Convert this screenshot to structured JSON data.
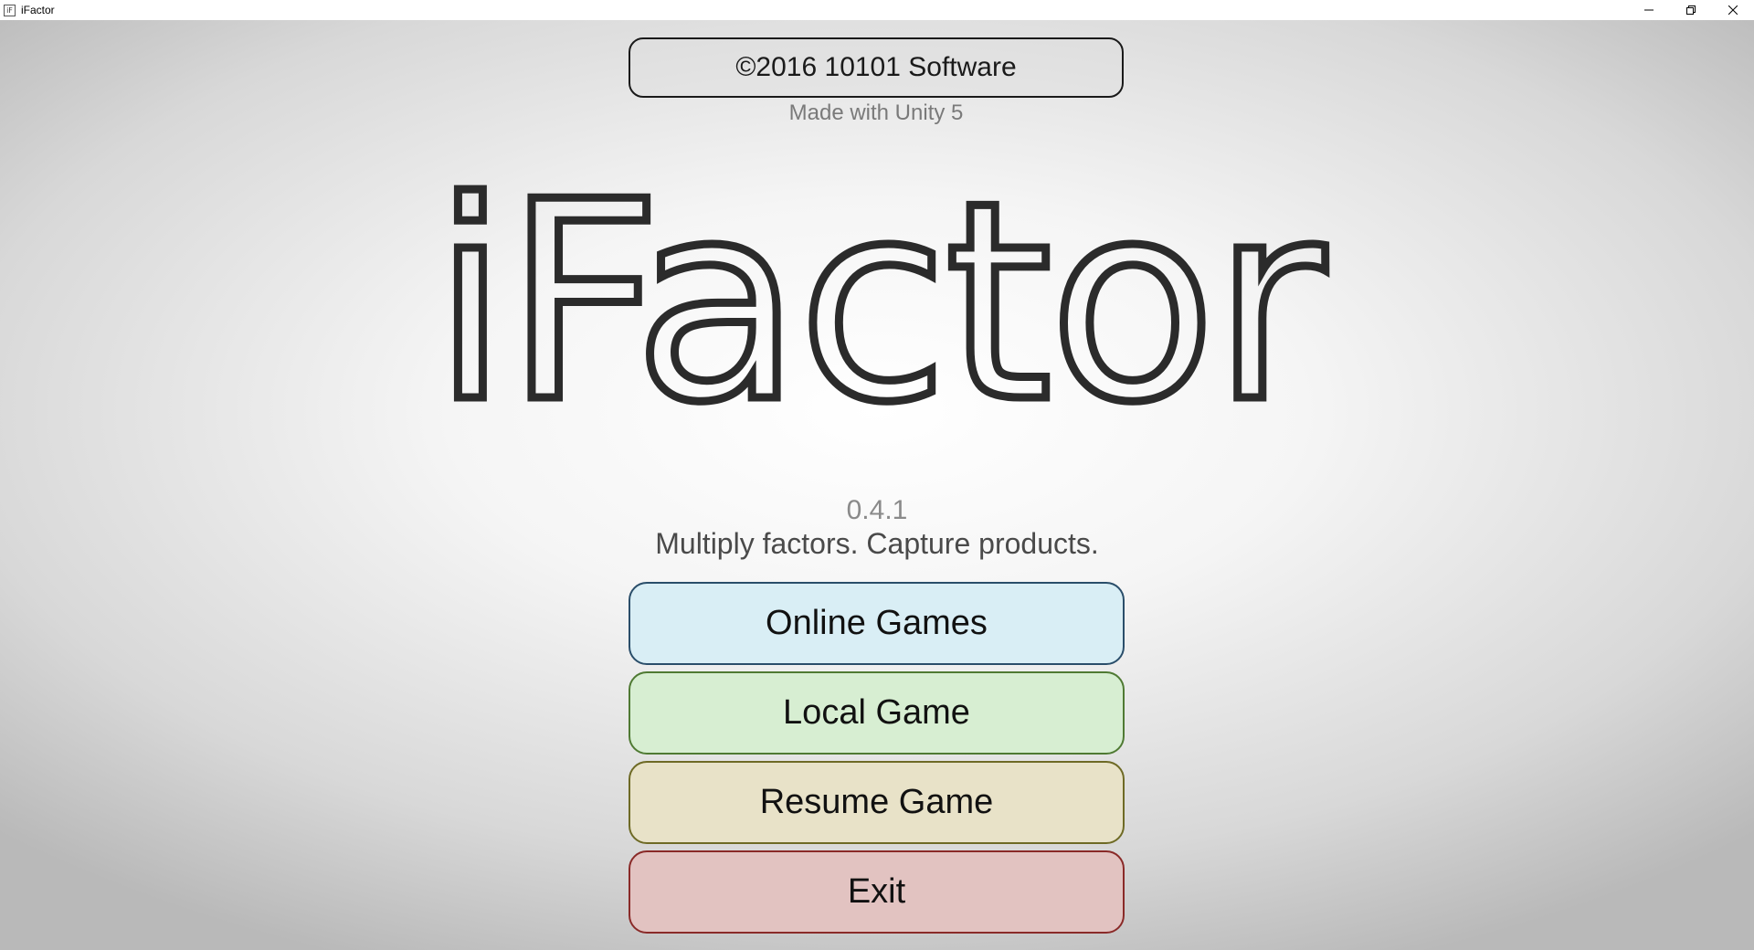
{
  "window": {
    "title": "iFactor",
    "icon_glyph": "iF"
  },
  "header": {
    "copyright": "©2016 10101 Software",
    "made_with": "Made with Unity 5"
  },
  "logo": {
    "text": "iFactor"
  },
  "info": {
    "version": "0.4.1",
    "tagline": "Multiply factors. Capture products."
  },
  "menu": {
    "online_label": "Online Games",
    "local_label": "Local Game",
    "resume_label": "Resume Game",
    "exit_label": "Exit"
  },
  "colors": {
    "online_bg": "#d9eef5",
    "local_bg": "#d7eed2",
    "resume_bg": "#e8e2c8",
    "exit_bg": "#e2c3c1"
  }
}
